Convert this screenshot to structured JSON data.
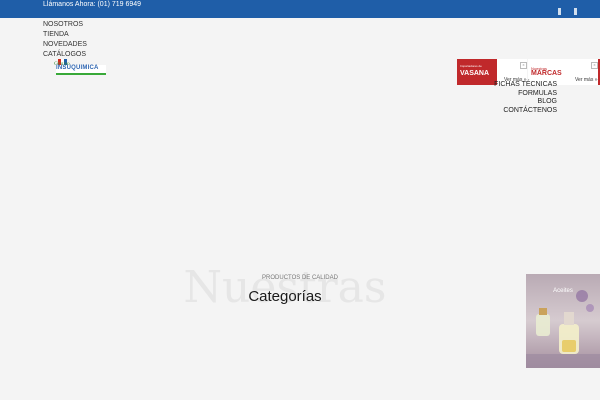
{
  "topbar": {
    "phone": "Llámanos Ahora: (01) 719 6949",
    "bg": "#1f5ea8"
  },
  "nav": {
    "items": [
      "NOSOTROS",
      "TIENDA",
      "NOVEDADES",
      "CATÁLOGOS"
    ]
  },
  "logo": {
    "tagline": "Grupo",
    "brand": "INSUQUIMICA"
  },
  "banners": [
    {
      "line1": "Importadores de",
      "line2": "VASANA",
      "more": "Ver más »",
      "close": "x"
    },
    {
      "line1": "Nuestras",
      "line2": "MARCAS",
      "more": "Ver más »",
      "close": "x"
    }
  ],
  "menu_right": {
    "items": [
      "FICHAS TÉCNICAS",
      "FORMULAS",
      "BLOG",
      "CONTÁCTENOS"
    ]
  },
  "section": {
    "pre": "PRODUCTOS DE CALIDAD",
    "background_word": "Nuestras",
    "title": "Categorías"
  },
  "category_card": {
    "label": "Aceites"
  },
  "colors": {
    "accent_red": "#c0292b",
    "brand_blue": "#1f5ea8",
    "brand_green": "#39a939"
  }
}
